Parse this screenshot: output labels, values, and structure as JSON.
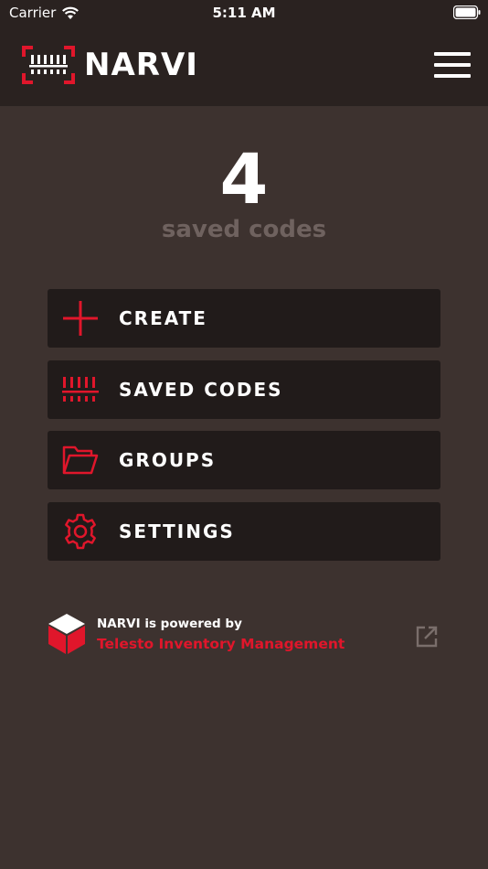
{
  "status": {
    "carrier": "Carrier",
    "time": "5:11 AM"
  },
  "header": {
    "app_name": "NARVI"
  },
  "summary": {
    "count": "4",
    "label": "saved codes"
  },
  "menu": [
    {
      "label": "CREATE",
      "icon": "plus-icon"
    },
    {
      "label": "SAVED CODES",
      "icon": "barcode-icon"
    },
    {
      "label": "GROUPS",
      "icon": "folder-icon"
    },
    {
      "label": "SETTINGS",
      "icon": "gear-icon"
    }
  ],
  "footer": {
    "powered_by": "NARVI is powered by",
    "link": "Telesto Inventory Management"
  },
  "colors": {
    "accent": "#e0162b",
    "background": "#3d322f",
    "header": "#2a2220",
    "button": "#211b1a"
  }
}
